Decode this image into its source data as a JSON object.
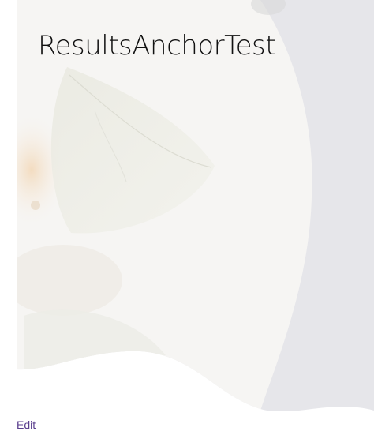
{
  "page": {
    "title": "ResultsAnchorTest",
    "hero_image": "pale-fruit-leaf-photo",
    "background_color": "#e8e8ec"
  },
  "footer": {
    "edit_label": "Edit",
    "link_color": "#5a3e8e"
  }
}
